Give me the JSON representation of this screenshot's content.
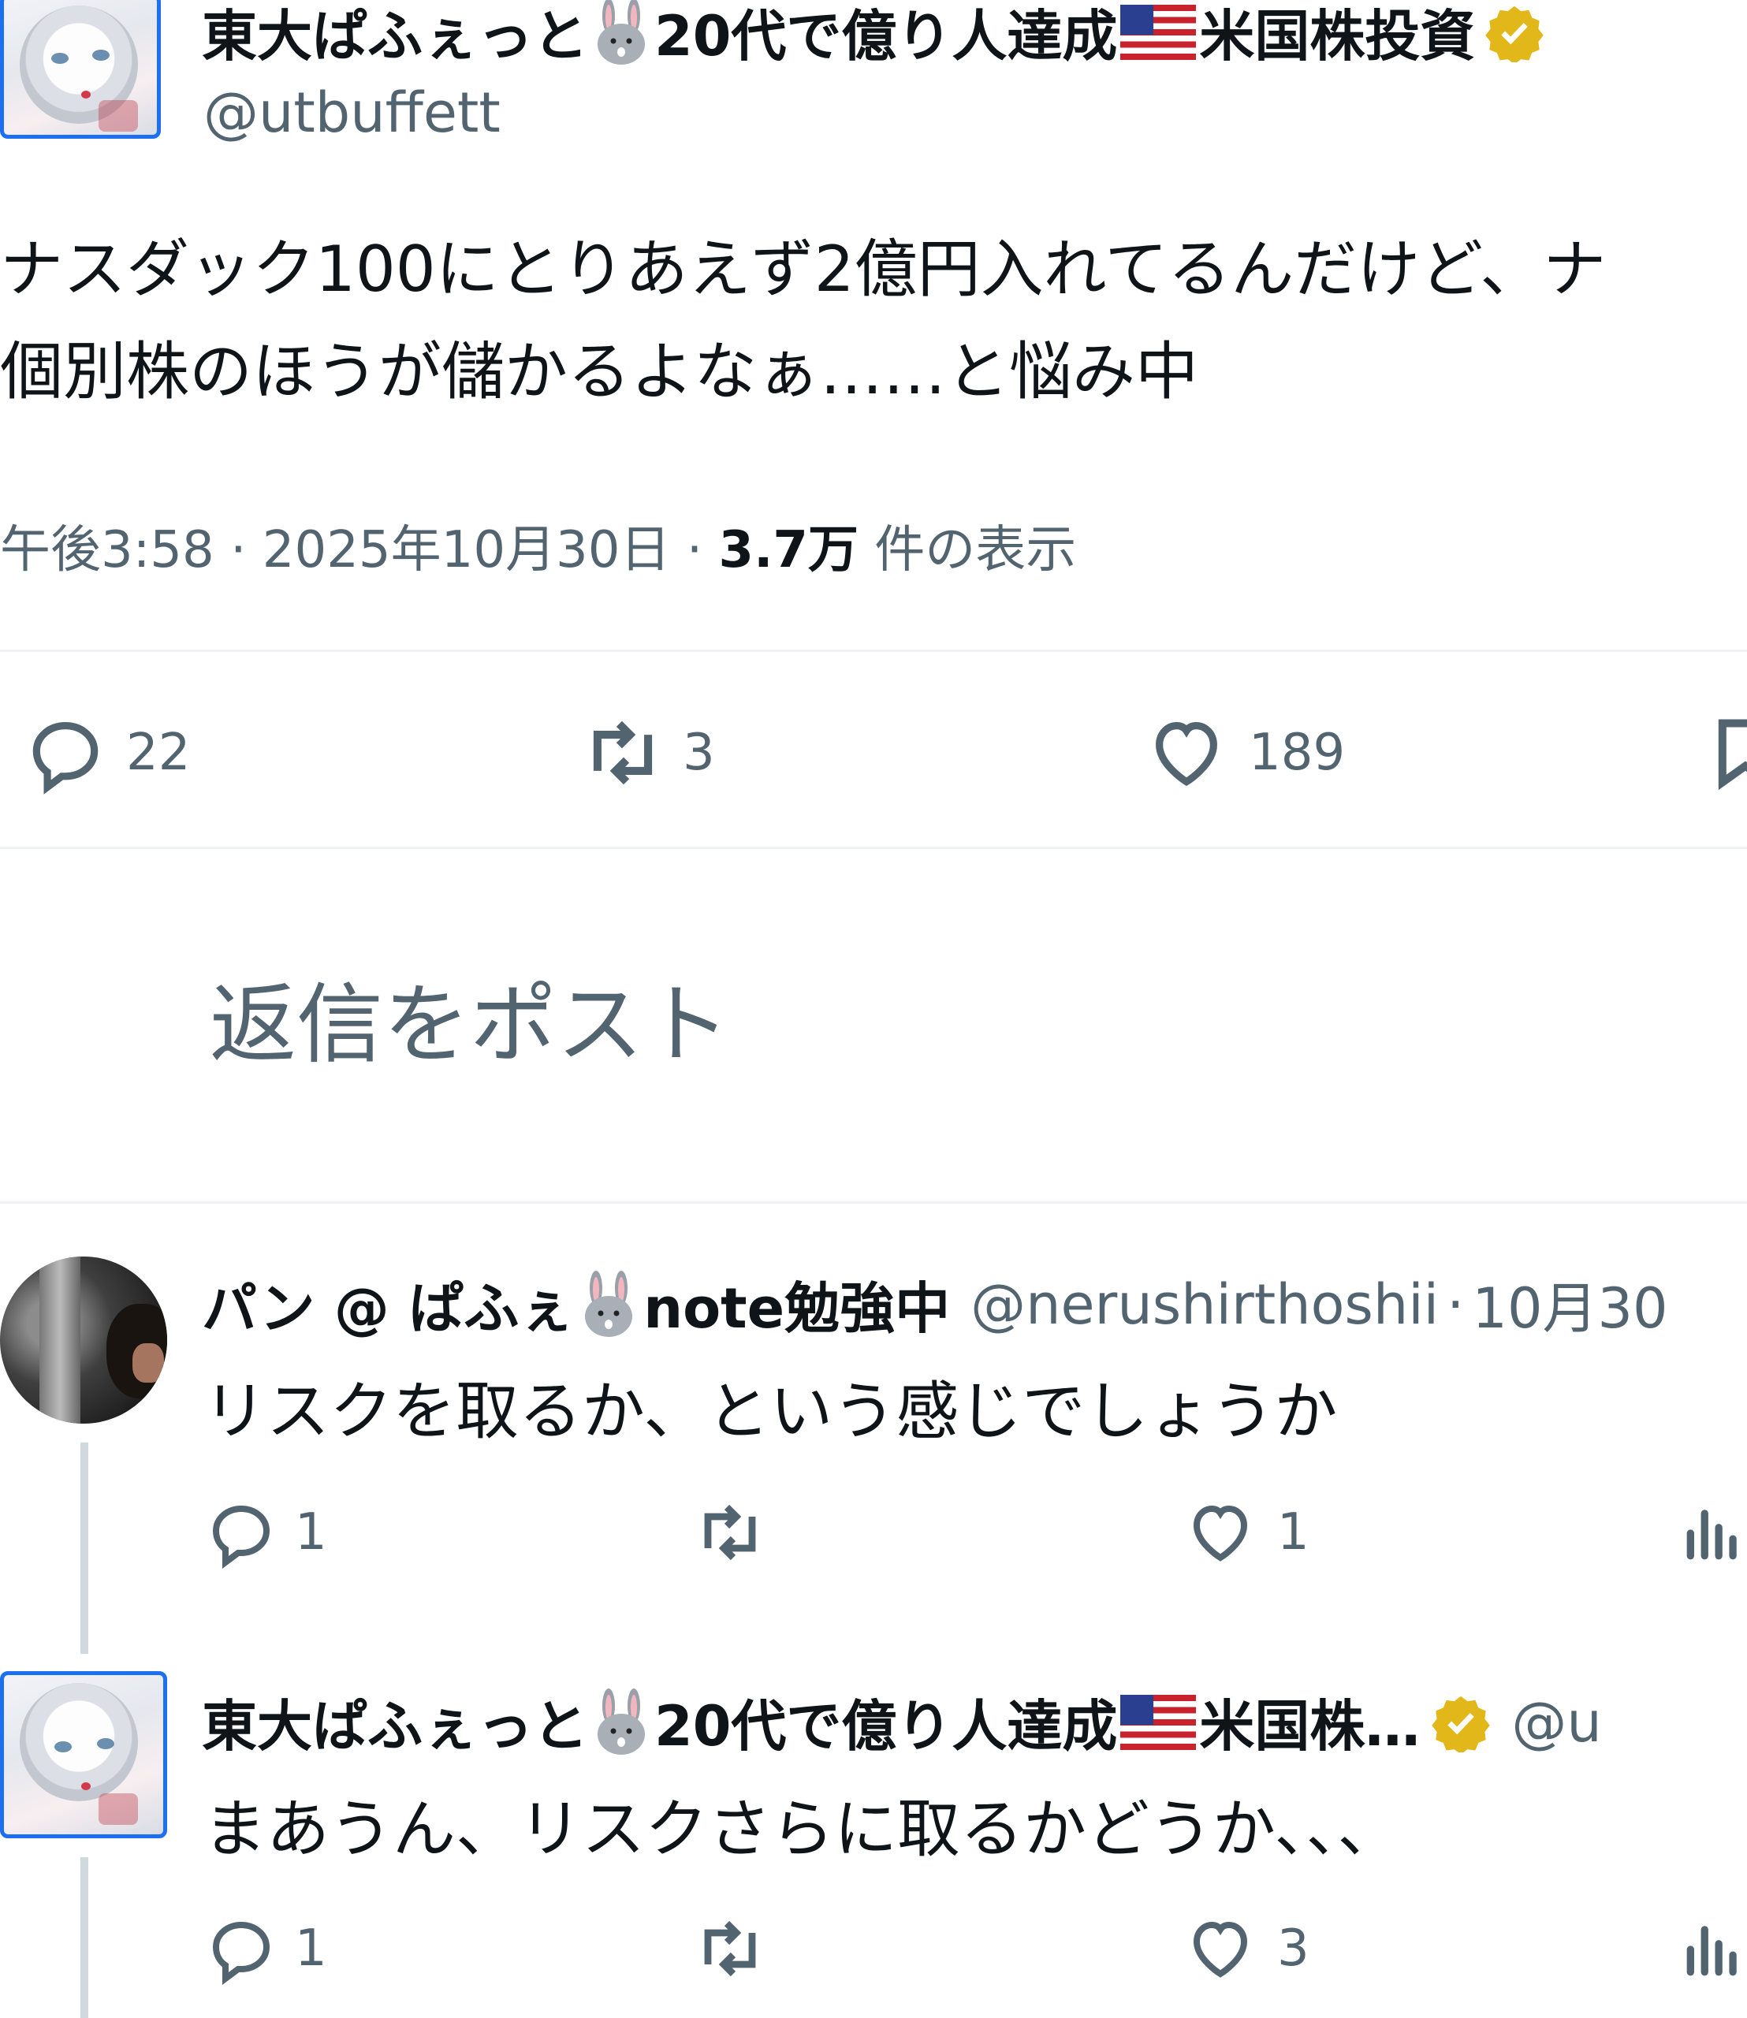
{
  "main_post": {
    "name_prefix": "東大ぱふぇっと",
    "name_mid": "20代で億り人達成",
    "name_suffix": "米国株投資",
    "handle": "@utbuffett",
    "text_line1": "ナスダック100にとりあえず2億円入れてるんだけど、ナ",
    "text_line2": "個別株のほうが儲かるよなぁ……と悩み中",
    "time": "午後3:58",
    "date": "2025年10月30日",
    "views_count": "3.7万",
    "views_label": "件の表示",
    "replies": "22",
    "reposts": "3",
    "likes": "189"
  },
  "composer": {
    "placeholder": "返信をポスト"
  },
  "replies": [
    {
      "name_prefix": "パン @ ぱふぇ",
      "name_suffix": "note勉強中",
      "handle": "@nerushirthoshii",
      "date": "10月30",
      "text": "リスクを取るか、という感じでしょうか",
      "replies": "1",
      "reposts": "",
      "likes": "1"
    },
    {
      "name_prefix": "東大ぱふぇっと",
      "name_mid": "20代で億り人達成",
      "name_suffix": "米国株…",
      "handle": "@u",
      "text": "まあうん、リスクさらに取るかどうか、、、",
      "replies": "1",
      "reposts": "",
      "likes": "3"
    }
  ],
  "colors": {
    "text": "#0f1419",
    "secondary": "#536471",
    "verified_gold": "#e2b719",
    "divider": "#eff3f4",
    "avatar_border": "#1d6ff2"
  }
}
